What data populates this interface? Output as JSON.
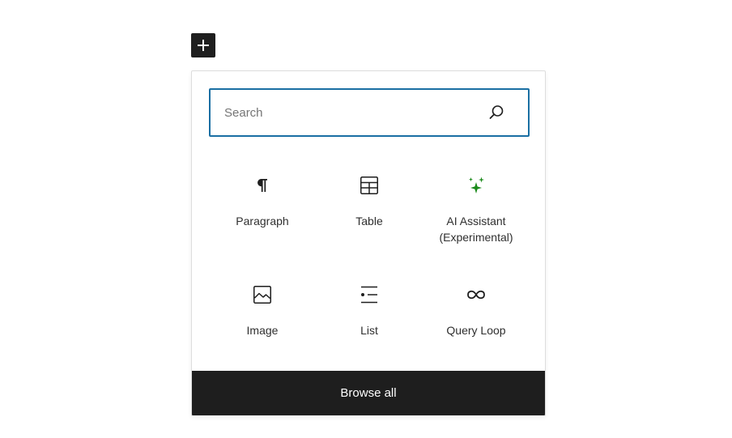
{
  "inserter": {
    "toggle_icon": "plus-icon"
  },
  "search": {
    "placeholder": "Search",
    "value": "",
    "icon": "search-icon"
  },
  "blocks": [
    {
      "label": "Paragraph",
      "icon": "paragraph-icon"
    },
    {
      "label": "Table",
      "icon": "table-icon"
    },
    {
      "label": "AI Assistant (Experimental)",
      "icon": "ai-sparkle-icon",
      "icon_color": "#1a8a1a"
    },
    {
      "label": "Image",
      "icon": "image-icon"
    },
    {
      "label": "List",
      "icon": "list-icon"
    },
    {
      "label": "Query Loop",
      "icon": "loop-icon"
    }
  ],
  "footer": {
    "browse_all_label": "Browse all"
  },
  "colors": {
    "accent": "#1a6fa3",
    "dark": "#1e1e1e",
    "ai_green": "#1a8a1a"
  }
}
